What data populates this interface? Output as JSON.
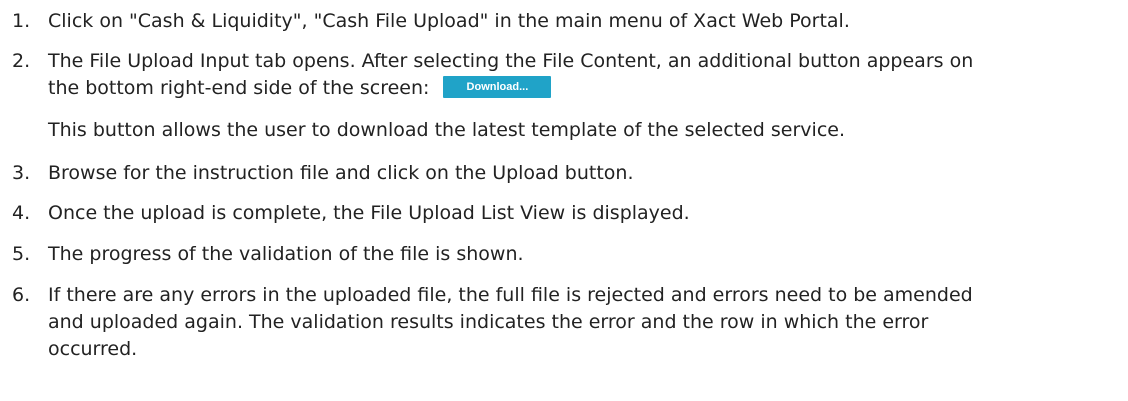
{
  "theme": {
    "button_color": "#20A3C8"
  },
  "steps": [
    {
      "number": "1.",
      "line1": "Click on \"Cash & Liquidity\", \"Cash File Upload\" in the main menu of Xact Web Portal."
    },
    {
      "number": "2.",
      "line1": "The File Upload Input tab opens. After selecting the File Content, an additional button appears on",
      "line2": "the bottom right-end side of the screen:",
      "button_label": "Download...",
      "note": "This button allows the user to download the latest template of the selected service."
    },
    {
      "number": "3.",
      "line1": "Browse for the instruction file and click on the Upload button."
    },
    {
      "number": "4.",
      "line1": "Once the upload is complete, the File Upload List View is displayed."
    },
    {
      "number": "5.",
      "line1": "The progress of the validation of the file is shown."
    },
    {
      "number": "6.",
      "line1": "If there are any errors in the uploaded file, the full file is rejected and errors need to be amended",
      "line2": "and uploaded again. The validation results indicates the error and the row in which the error",
      "line3": "occurred."
    }
  ]
}
